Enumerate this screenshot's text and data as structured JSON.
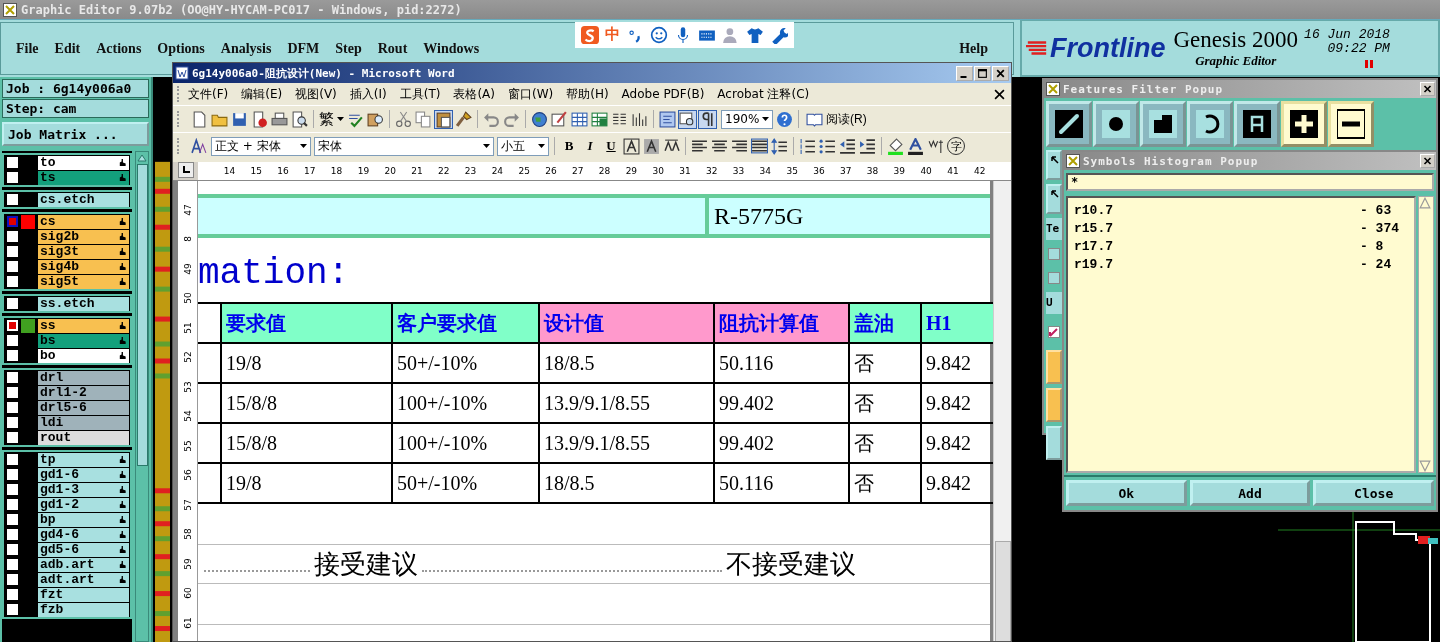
{
  "app": {
    "title": "Graphic Editor 9.07b2 (OO@HY-HYCAM-PC017 - Windows, pid:2272)",
    "menu": [
      "File",
      "Edit",
      "Actions",
      "Options",
      "Analysis",
      "DFM",
      "Step",
      "Rout",
      "Windows"
    ],
    "help": "Help",
    "ime_label": "中"
  },
  "brand": {
    "logo": "Frontline",
    "product": "Genesis 2000",
    "subtitle": "Graphic Editor",
    "date": "16 Jun 2018",
    "time": "09:22 PM"
  },
  "job_panel": {
    "job": "Job : 6g14y006a0",
    "step": "Step: cam",
    "matrix_button": "Job Matrix ..."
  },
  "layer_groups": [
    {
      "layers": [
        {
          "name": "to",
          "kind": "outer",
          "pointer": true,
          "affected": false,
          "work": false
        },
        {
          "name": "ts",
          "kind": "mask",
          "pointer": true,
          "affected": false,
          "work": false
        }
      ]
    },
    {
      "layers": [
        {
          "name": "cs.etch",
          "kind": "doc",
          "pointer": false,
          "affected": false,
          "work": false
        }
      ]
    },
    {
      "layers": [
        {
          "name": "cs",
          "kind": "signal",
          "pointer": true,
          "affected": true,
          "work": true,
          "color": "#ff0000"
        },
        {
          "name": "sig2b",
          "kind": "signal",
          "pointer": true,
          "affected": false,
          "work": false
        },
        {
          "name": "sig3t",
          "kind": "signal",
          "pointer": true,
          "affected": false,
          "work": false
        },
        {
          "name": "sig4b",
          "kind": "signal",
          "pointer": true,
          "affected": false,
          "work": false
        },
        {
          "name": "sig5t",
          "kind": "signal",
          "pointer": true,
          "affected": false,
          "work": false
        }
      ]
    },
    {
      "layers": [
        {
          "name": "ss.etch",
          "kind": "doc",
          "pointer": false,
          "affected": false,
          "work": false
        }
      ]
    },
    {
      "layers": [
        {
          "name": "ss",
          "kind": "signal",
          "pointer": true,
          "affected": true,
          "work": false,
          "color": "#40a020"
        },
        {
          "name": "bs",
          "kind": "mask",
          "pointer": true,
          "affected": false,
          "work": false
        },
        {
          "name": "bo",
          "kind": "outer",
          "pointer": true,
          "affected": false,
          "work": false
        }
      ]
    },
    {
      "layers": [
        {
          "name": "drl",
          "kind": "drill",
          "pointer": false,
          "affected": false,
          "work": false
        },
        {
          "name": "drl1-2",
          "kind": "drill",
          "pointer": false,
          "affected": false,
          "work": false
        },
        {
          "name": "drl5-6",
          "kind": "drill",
          "pointer": false,
          "affected": false,
          "work": false
        },
        {
          "name": "ldi",
          "kind": "drill",
          "pointer": false,
          "affected": false,
          "work": false
        },
        {
          "name": "rout",
          "kind": "rout",
          "pointer": false,
          "affected": false,
          "work": false
        }
      ]
    },
    {
      "layers": [
        {
          "name": "tp",
          "kind": "doc",
          "pointer": true,
          "affected": false,
          "work": false
        },
        {
          "name": "gd1-6",
          "kind": "doc",
          "pointer": true,
          "affected": false,
          "work": false
        },
        {
          "name": "gd1-3",
          "kind": "doc",
          "pointer": true,
          "affected": false,
          "work": false
        },
        {
          "name": "gd1-2",
          "kind": "doc",
          "pointer": true,
          "affected": false,
          "work": false
        },
        {
          "name": "bp",
          "kind": "doc",
          "pointer": true,
          "affected": false,
          "work": false
        },
        {
          "name": "gd4-6",
          "kind": "doc",
          "pointer": true,
          "affected": false,
          "work": false
        },
        {
          "name": "gd5-6",
          "kind": "doc",
          "pointer": true,
          "affected": false,
          "work": false
        },
        {
          "name": "adb.art",
          "kind": "doc",
          "pointer": true,
          "affected": false,
          "work": false
        },
        {
          "name": "adt.art",
          "kind": "doc",
          "pointer": true,
          "affected": false,
          "work": false
        },
        {
          "name": "fzt",
          "kind": "doc",
          "pointer": false,
          "affected": false,
          "work": false
        },
        {
          "name": "fzb",
          "kind": "doc",
          "pointer": false,
          "affected": false,
          "work": false
        }
      ]
    }
  ],
  "word": {
    "title": "6g14y006a0-阻抗设计(New) - Microsoft Word",
    "menu": [
      "文件(F)",
      "编辑(E)",
      "视图(V)",
      "插入(I)",
      "工具(T)",
      "表格(A)",
      "窗口(W)",
      "帮助(H)",
      "Adobe PDF(B)",
      "Acrobat 注释(C)"
    ],
    "traditional": "繁",
    "zoom": "190%",
    "read_button": "阅读(R)",
    "style": "正文 + 宋体",
    "font": "宋体",
    "size": "小五",
    "format_letters": [
      "B",
      "I",
      "U"
    ],
    "enclosed_char": "字",
    "ruler": [
      "14",
      "15",
      "16",
      "17",
      "18",
      "19",
      "20",
      "21",
      "22",
      "23",
      "24",
      "25",
      "26",
      "27",
      "28",
      "29",
      "30",
      "31",
      "32",
      "33",
      "34",
      "35",
      "36",
      "37",
      "38",
      "39",
      "40",
      "41",
      "42"
    ],
    "vruler": [
      "47",
      "8",
      "49",
      "50",
      "51",
      "52",
      "53",
      "54",
      "55",
      "56",
      "57",
      "58",
      "59",
      "60",
      "61"
    ],
    "top_cell": "R-5775G",
    "heading": "mation:",
    "columns": [
      {
        "label": "要求值",
        "color": "#80ffc8"
      },
      {
        "label": "客户要求值",
        "color": "#80ffc8"
      },
      {
        "label": "设计值",
        "color": "#ff99cc"
      },
      {
        "label": "阻抗计算值",
        "color": "#ff99cc"
      },
      {
        "label": "盖油",
        "color": "#80ffc8"
      },
      {
        "label": "H1",
        "color": "#80ffc8"
      }
    ],
    "rows": [
      [
        "19/8",
        "50+/-10%",
        "18/8.5",
        "50.116",
        "否",
        "9.842"
      ],
      [
        "15/8/8",
        "100+/-10%",
        "13.9/9.1/8.55",
        "99.402",
        "否",
        "9.842"
      ],
      [
        "15/8/8",
        "100+/-10%",
        "13.9/9.1/8.55",
        "99.402",
        "否",
        "9.842"
      ],
      [
        "19/8",
        "50+/-10%",
        "18/8.5",
        "50.116",
        "否",
        "9.842"
      ]
    ],
    "choices": [
      "接受建议",
      "不接受建议"
    ]
  },
  "features_popup": {
    "title": "Features Filter Popup",
    "side_labels": [
      "Te",
      "U"
    ],
    "side_checkboxes": [
      {
        "checked": false
      },
      {
        "checked": false
      },
      {
        "checked": true
      }
    ]
  },
  "histogram_popup": {
    "title": "Symbols Histogram Popup",
    "filter": "*",
    "rows": [
      {
        "symbol": "r10.7",
        "count": "- 63"
      },
      {
        "symbol": "r15.7",
        "count": "- 374"
      },
      {
        "symbol": "r17.7",
        "count": "- 8"
      },
      {
        "symbol": "r19.7",
        "count": "- 24"
      }
    ],
    "buttons": [
      "Ok",
      "Add",
      "Close"
    ]
  }
}
